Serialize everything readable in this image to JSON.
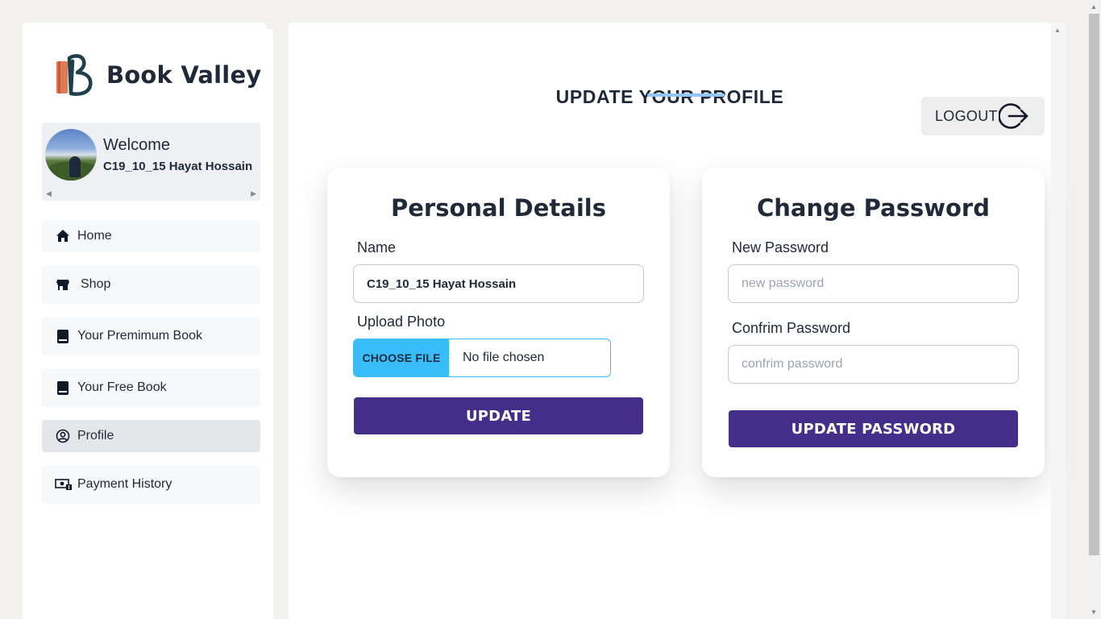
{
  "brand": {
    "name": "Book Valley",
    "logo_icon": "book-b-logo-icon"
  },
  "user": {
    "welcome": "Welcome",
    "name": "C19_10_15 Hayat Hossain"
  },
  "sidebar": {
    "items": [
      {
        "label": "Home",
        "icon": "home-icon"
      },
      {
        "label": "Shop",
        "icon": "store-icon"
      },
      {
        "label": "Your Premimum Book",
        "icon": "book-icon"
      },
      {
        "label": "Your Free Book",
        "icon": "book-icon"
      },
      {
        "label": "Profile",
        "icon": "user-circle-icon",
        "active": true
      },
      {
        "label": "Payment History",
        "icon": "money-icon"
      }
    ]
  },
  "header": {
    "title": "UPDATE YOUR PROFILE",
    "logout_label": "LOGOUT"
  },
  "personal": {
    "title": "Personal Details",
    "name_label": "Name",
    "name_value": "C19_10_15 Hayat Hossain",
    "upload_label": "Upload Photo",
    "file_button": "CHOOSE FILE",
    "file_status": "No file chosen",
    "update_label": "UPDATE"
  },
  "password": {
    "title": "Change Password",
    "new_label": "New Password",
    "new_placeholder": "new password",
    "confirm_label": "Confrim Password",
    "confirm_placeholder": "confrim password",
    "update_label": "UPDATE PASSWORD"
  },
  "colors": {
    "accent": "#432e8a",
    "file_button": "#38bdf8",
    "title_underline": "#93c5fd",
    "background": "#f2f1ed"
  }
}
